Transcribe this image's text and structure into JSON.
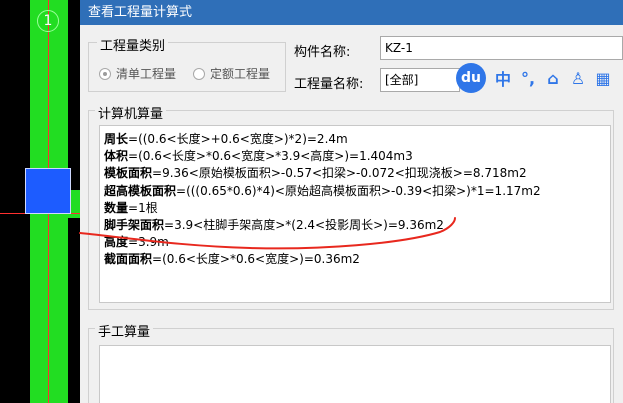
{
  "cad": {
    "axis_label": "1"
  },
  "dialog": {
    "title": "查看工程量计算式",
    "qty_type": {
      "legend": "工程量类别",
      "options": [
        {
          "label": "清单工程量",
          "checked": true
        },
        {
          "label": "定额工程量",
          "checked": false
        }
      ]
    },
    "component": {
      "label": "构件名称:",
      "value": "KZ-1"
    },
    "quantity_name": {
      "label": "工程量名称:",
      "value": "[全部]"
    },
    "calc": {
      "legend": "计算机算量",
      "lines": [
        {
          "name": "周长",
          "expr": "=((0.6<长度>+0.6<宽度>)*2)=2.4m"
        },
        {
          "name": "体积",
          "expr": "=(0.6<长度>*0.6<宽度>*3.9<高度>)=1.404m3"
        },
        {
          "name": "模板面积",
          "expr": "=9.36<原始模板面积>-0.57<扣梁>-0.072<扣现浇板>=8.718m2"
        },
        {
          "name": "超高模板面积",
          "expr": "=(((0.65*0.6)*4)<原始超高模板面积>-0.39<扣梁>)*1=1.17m2"
        },
        {
          "name": "数量",
          "expr": "=1根"
        },
        {
          "name": "脚手架面积",
          "expr": "=3.9<柱脚手架高度>*(2.4<投影周长>)=9.36m2"
        },
        {
          "name": "高度",
          "expr": "=3.9m"
        },
        {
          "name": "截面面积",
          "expr": "=(0.6<长度>*0.6<宽度>)=0.36m2"
        }
      ]
    },
    "manual": {
      "legend": "手工算量"
    }
  },
  "ime": {
    "logo": "du",
    "buttons": [
      {
        "glyph": "中",
        "name": "ime-chinese-mode-button"
      },
      {
        "glyph": "°,",
        "name": "ime-punctuation-button"
      },
      {
        "glyph": "⌂",
        "name": "ime-toolbox-icon"
      },
      {
        "glyph": "♙",
        "name": "ime-user-icon"
      },
      {
        "glyph": "▦",
        "name": "ime-grid-icon"
      }
    ]
  },
  "colors": {
    "titlebar": "#2f6fb8",
    "cad_green": "#22dd22",
    "cad_blue": "#1d5cff",
    "cad_red": "#ff3030",
    "annotation_red": "#e8281e",
    "ime_blue": "#2f76e8"
  }
}
